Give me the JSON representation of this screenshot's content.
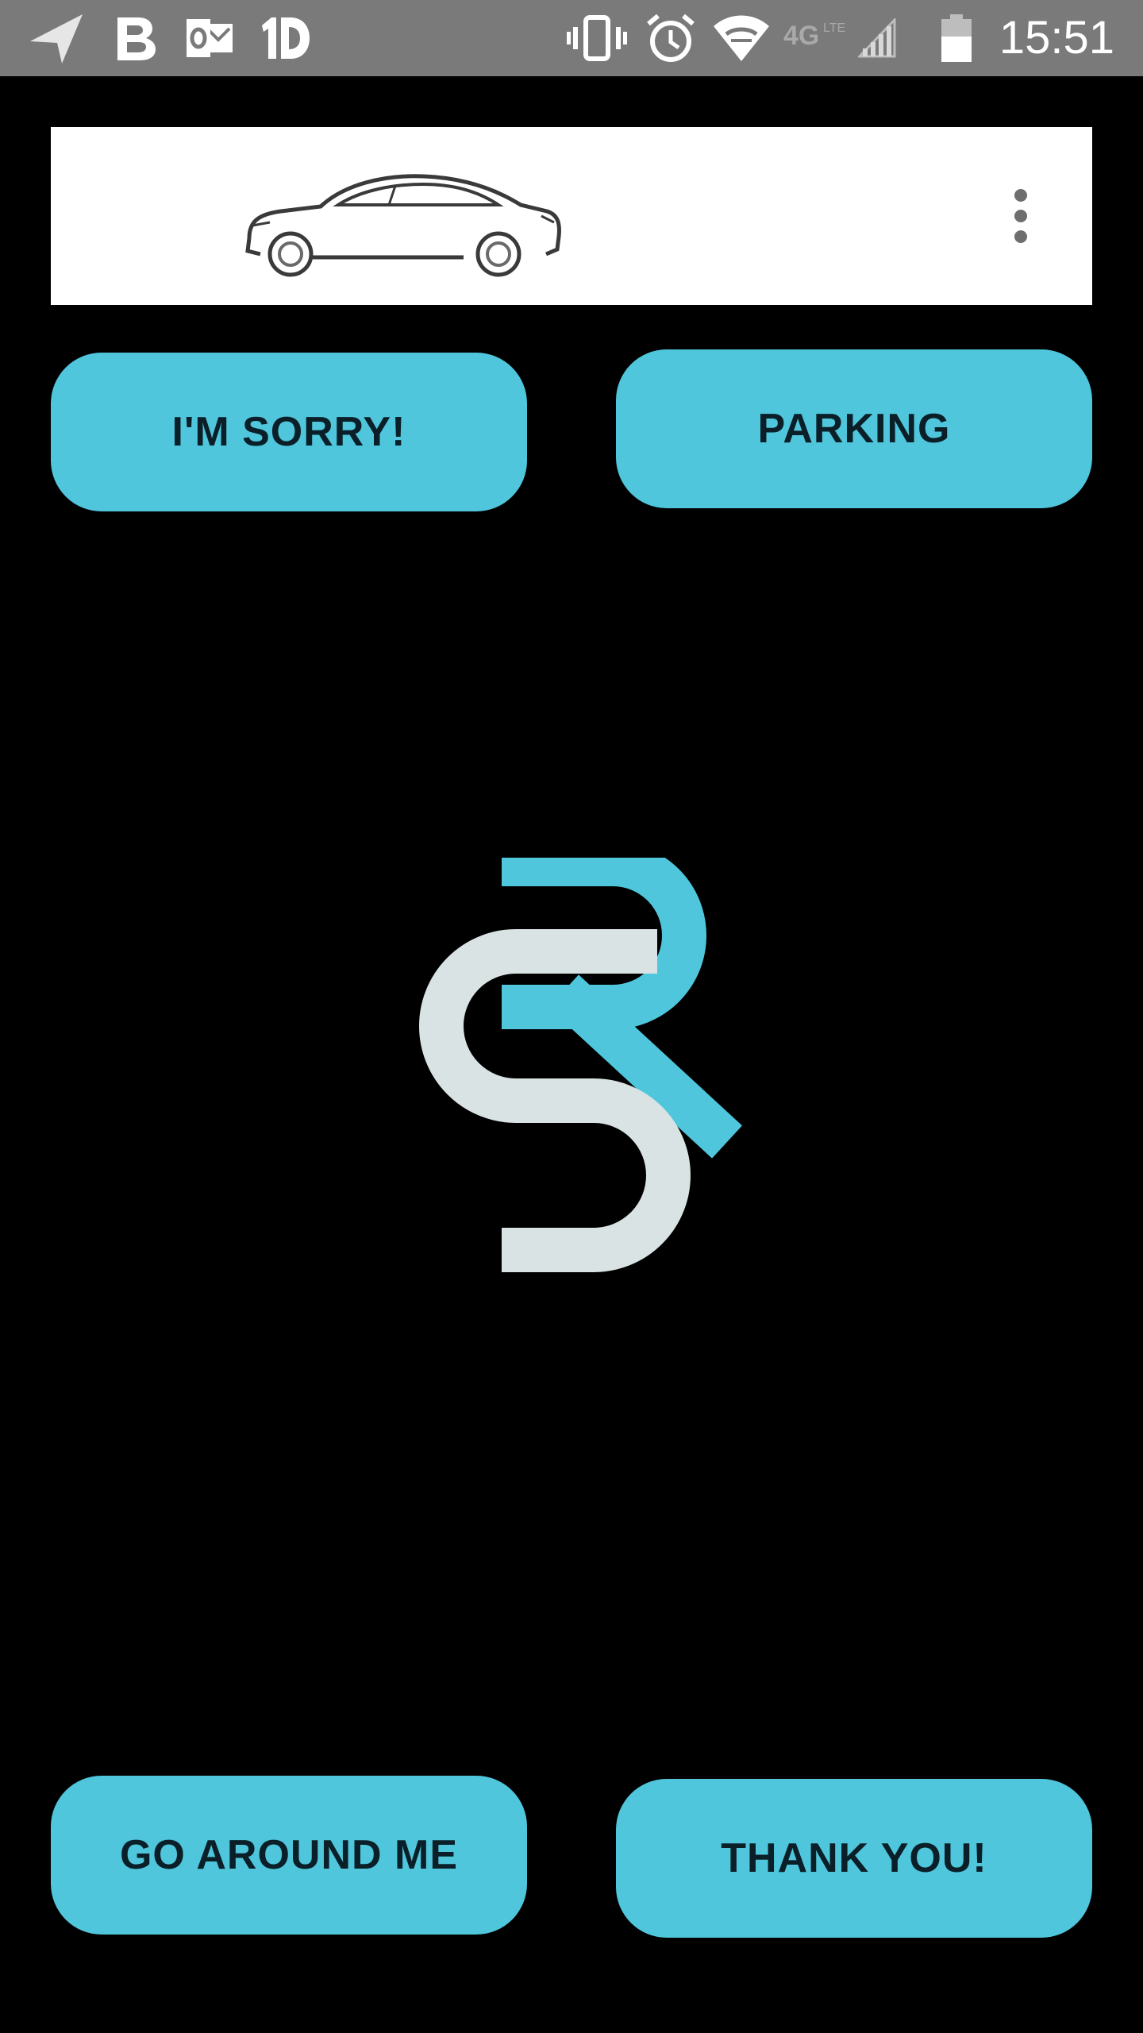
{
  "status_bar": {
    "time": "15:51",
    "icons": [
      "back-arrow-icon",
      "b-app-icon",
      "outlook-icon",
      "one-d-icon",
      "vibrate-icon",
      "alarm-icon",
      "wifi-icon",
      "4g-lte-icon",
      "signal-icon",
      "battery-icon"
    ],
    "background": "#7a7a7a"
  },
  "header": {
    "logo_icon": "car-outline-icon",
    "menu_icon": "more-vertical-icon"
  },
  "buttons": {
    "sorry": "I'M SORRY!",
    "parking": "PARKING",
    "go_around": "GO AROUND ME",
    "thank_you": "THANK YOU!"
  },
  "center_logo": {
    "icon": "sr-logo-icon",
    "colors": {
      "accent": "#4fc6dc",
      "light": "#d9e3e3"
    }
  },
  "colors": {
    "button_bg": "#4fc6dc",
    "button_text": "#0a1f28",
    "page_bg": "#000000"
  }
}
